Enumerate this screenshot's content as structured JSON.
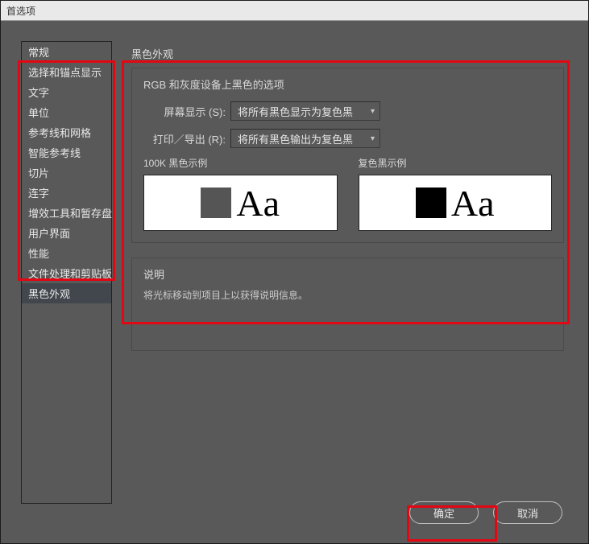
{
  "window": {
    "title": "首选项"
  },
  "sidebar": {
    "items": [
      {
        "label": "常规"
      },
      {
        "label": "选择和锚点显示"
      },
      {
        "label": "文字"
      },
      {
        "label": "单位"
      },
      {
        "label": "参考线和网格"
      },
      {
        "label": "智能参考线"
      },
      {
        "label": "切片"
      },
      {
        "label": "连字"
      },
      {
        "label": "增效工具和暂存盘"
      },
      {
        "label": "用户界面"
      },
      {
        "label": "性能"
      },
      {
        "label": "文件处理和剪贴板"
      },
      {
        "label": "黑色外观"
      }
    ],
    "selected": "黑色外观"
  },
  "main": {
    "section_title": "黑色外观",
    "group_title": "RGB 和灰度设备上黑色的选项",
    "screen_label": "屏幕显示 (S):",
    "screen_value": "将所有黑色显示为复色黑",
    "print_label": "打印／导出 (R):",
    "print_value": "将所有黑色输出为复色黑",
    "sample1_label": "100K 黑色示例",
    "sample2_label": "复色黑示例",
    "aa_text": "Aa",
    "desc_title": "说明",
    "desc_text": "将光标移动到项目上以获得说明信息。"
  },
  "buttons": {
    "ok": "确定",
    "cancel": "取消"
  }
}
